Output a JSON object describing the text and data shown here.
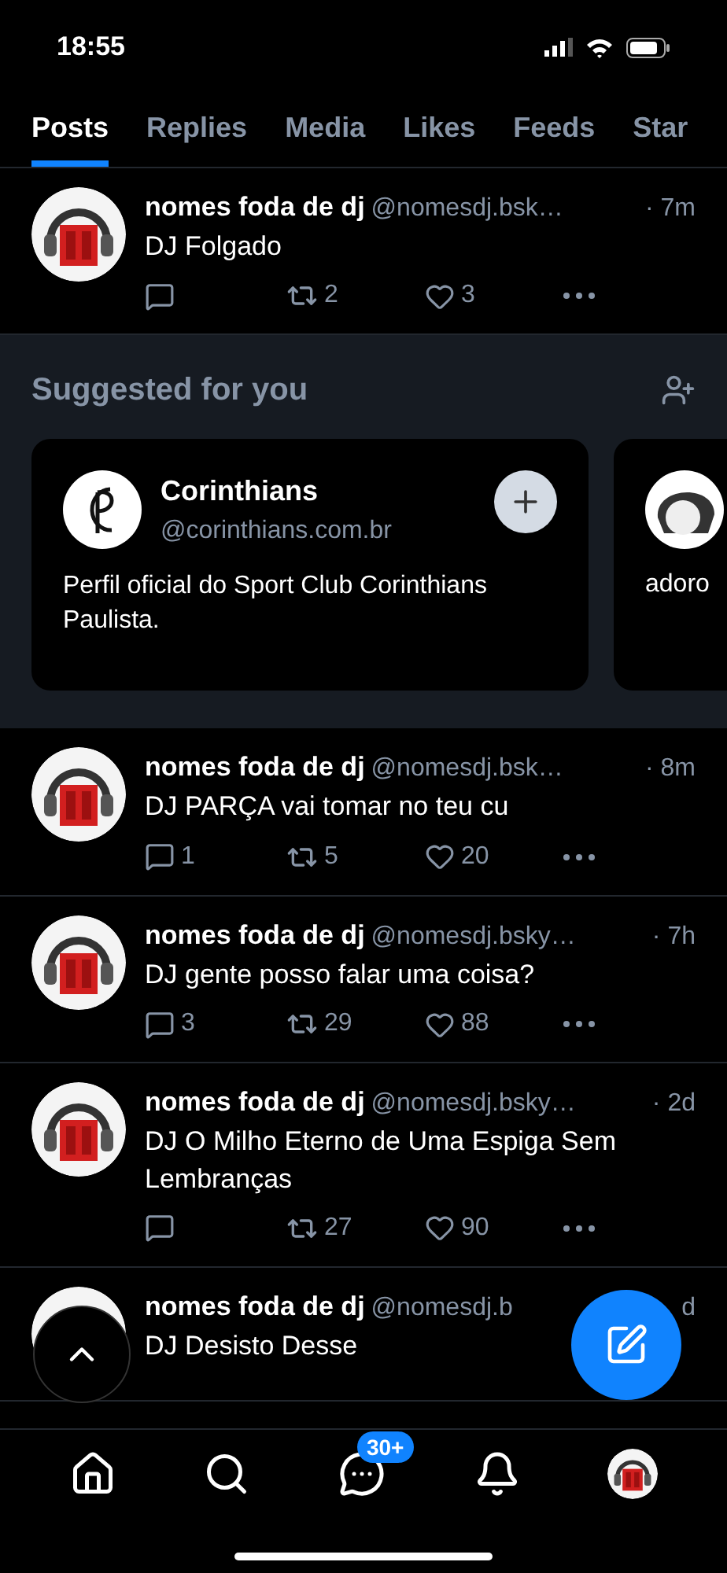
{
  "status_bar": {
    "time": "18:55"
  },
  "tabs": [
    {
      "label": "Posts",
      "selected": true
    },
    {
      "label": "Replies",
      "selected": false
    },
    {
      "label": "Media",
      "selected": false
    },
    {
      "label": "Likes",
      "selected": false
    },
    {
      "label": "Feeds",
      "selected": false
    },
    {
      "label": "Star",
      "selected": false
    }
  ],
  "posts_before": [
    {
      "name": "nomes foda de dj",
      "handle": "@nomesdj.bsk…",
      "time": "· 7m",
      "text": "DJ Folgado",
      "reposts": "2",
      "likes": "3"
    }
  ],
  "suggestions": {
    "title": "Suggested for you",
    "cards": [
      {
        "name": "Corinthians",
        "handle": "@corinthians.com.br",
        "bio": "Perfil oficial do Sport Club Corinthians Paulista."
      },
      {
        "bio": "adoro"
      }
    ]
  },
  "posts": [
    {
      "name": "nomes foda de dj",
      "handle": "@nomesdj.bsk…",
      "time": "· 8m",
      "text": "DJ PARÇA vai tomar no teu cu",
      "replies": "1",
      "reposts": "5",
      "likes": "20"
    },
    {
      "name": "nomes foda de dj",
      "handle": "@nomesdj.bsky…",
      "time": "· 7h",
      "text": "DJ gente posso falar uma coisa?",
      "replies": "3",
      "reposts": "29",
      "likes": "88"
    },
    {
      "name": "nomes foda de dj",
      "handle": "@nomesdj.bsky…",
      "time": "· 2d",
      "text": "DJ O Milho Eterno de Uma Espiga Sem Lembranças",
      "reposts": "27",
      "likes": "90"
    },
    {
      "name": "nomes foda de dj",
      "handle": "@nomesdj.b",
      "time": "d",
      "text": "DJ Desisto Desse"
    }
  ],
  "bottom_nav": {
    "messages_badge": "30+"
  }
}
